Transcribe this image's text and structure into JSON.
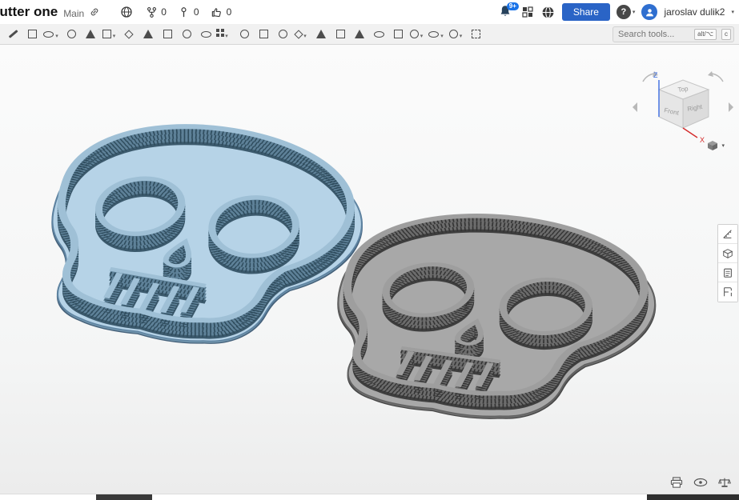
{
  "header": {
    "title": "cutter one",
    "branch": "Main",
    "stats": [
      {
        "icon": "fork-icon",
        "count": "0"
      },
      {
        "icon": "pin-icon",
        "count": "0"
      },
      {
        "icon": "thumbs-up-icon",
        "count": "0"
      }
    ],
    "notification_badge": "9+",
    "share_label": "Share",
    "help_label": "?",
    "user_name": "jaroslav dulik2"
  },
  "toolbar": {
    "search_placeholder": "Search tools...",
    "shortcut_keys": [
      "alt/⌥",
      "c"
    ],
    "tools": [
      {
        "name": "sketch",
        "shape": "pencil",
        "caret": false
      },
      {
        "name": "extrude",
        "shape": "square",
        "caret": false
      },
      {
        "name": "revolve",
        "shape": "cylinder",
        "caret": true
      },
      {
        "name": "sweep",
        "shape": "circle",
        "caret": false
      },
      {
        "name": "loft",
        "shape": "triangle",
        "caret": false
      },
      {
        "name": "fillet",
        "shape": "square",
        "caret": true
      },
      {
        "name": "chamfer",
        "shape": "diamond",
        "caret": false
      },
      {
        "name": "draft",
        "shape": "triangle",
        "caret": false
      },
      {
        "name": "rib",
        "shape": "square",
        "caret": false
      },
      {
        "name": "shell",
        "shape": "circle",
        "caret": false
      },
      {
        "name": "hole",
        "shape": "cylinder",
        "caret": false
      },
      {
        "name": "linear-pattern",
        "shape": "grid",
        "caret": true
      },
      {
        "name": "circular-pattern",
        "shape": "circle",
        "caret": false
      },
      {
        "name": "mirror",
        "shape": "square",
        "caret": false
      },
      {
        "name": "boolean",
        "shape": "circle",
        "caret": false
      },
      {
        "name": "split",
        "shape": "diamond",
        "caret": true
      },
      {
        "name": "transform",
        "shape": "triangle",
        "caret": false
      },
      {
        "name": "delete-part",
        "shape": "square",
        "caret": false
      },
      {
        "name": "move-face",
        "shape": "triangle",
        "caret": false
      },
      {
        "name": "offset-surface",
        "shape": "cylinder",
        "caret": false
      },
      {
        "name": "thicken",
        "shape": "square",
        "caret": false
      },
      {
        "name": "appearance",
        "shape": "circle",
        "caret": true
      },
      {
        "name": "display-mode",
        "shape": "cylinder",
        "caret": true
      },
      {
        "name": "section-view",
        "shape": "circle",
        "caret": true
      },
      {
        "name": "zoom-to-fit",
        "shape": "dashed",
        "caret": false
      }
    ]
  },
  "viewcube": {
    "top": "Top",
    "front": "Front",
    "right": "Right",
    "axis_z": "Z",
    "axis_x": "X"
  },
  "colors": {
    "share_button": "#2a64c6",
    "notification_badge": "#1a73e8",
    "selected_part_blue": "#9fc0d6",
    "part_gray": "#9e9e9e"
  }
}
